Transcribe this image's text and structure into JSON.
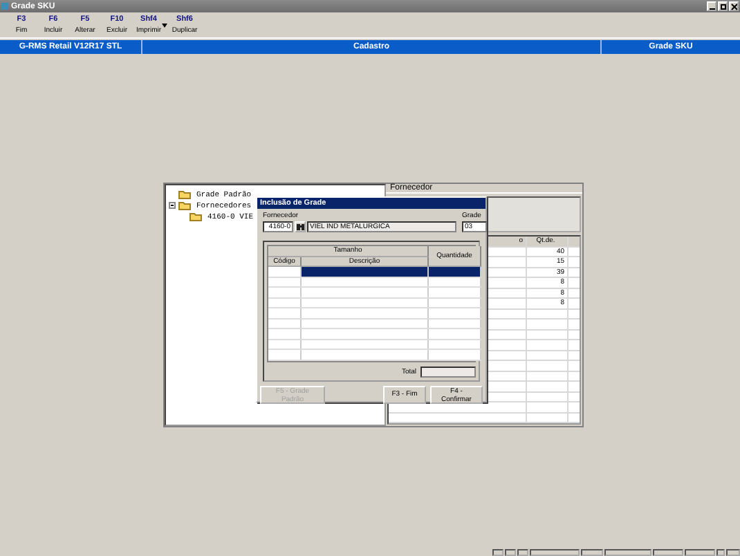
{
  "window": {
    "title": "Grade SKU"
  },
  "toolbar": [
    {
      "key": "F3",
      "label": "Fim",
      "dropdown": false
    },
    {
      "key": "F6",
      "label": "Incluir",
      "dropdown": false
    },
    {
      "key": "F5",
      "label": "Alterar",
      "dropdown": false
    },
    {
      "key": "F10",
      "label": "Excluir",
      "dropdown": false
    },
    {
      "key": "Shf4",
      "label": "Imprimir",
      "dropdown": true
    },
    {
      "key": "Shf6",
      "label": "Duplicar",
      "dropdown": false
    }
  ],
  "header_bar": [
    "G-RMS Retail V12R17 STL",
    "Cadastro",
    "Grade SKU"
  ],
  "tree": [
    {
      "label": "Grade Padrão"
    },
    {
      "label": "Fornecedores",
      "expanded": true,
      "children": [
        {
          "label": "4160-0 VIE"
        }
      ]
    }
  ],
  "right_panel": {
    "title": "Fornecedor",
    "columns": [
      "o",
      "Qt.de."
    ],
    "rows": [
      "40",
      "15",
      "39",
      "8",
      "8",
      "8"
    ]
  },
  "dialog": {
    "title": "Inclusão de Grade",
    "supplier_label": "Fornecedor",
    "supplier_code": "4160-0",
    "supplier_name": "VIEL IND METALURGICA",
    "grade_label": "Grade",
    "grade": "03",
    "group_header": "Tamanho",
    "columns": [
      "Código",
      "Descrição",
      "Quantidade"
    ],
    "rows": [
      {
        "selected": true
      },
      {
        "selected": false
      },
      {
        "selected": false
      },
      {
        "selected": false
      },
      {
        "selected": false
      },
      {
        "selected": false
      },
      {
        "selected": false
      },
      {
        "selected": false
      },
      {
        "selected": false
      }
    ],
    "total_label": "Total",
    "buttons": [
      {
        "label": "F5 - Grade Padrão",
        "disabled": true
      },
      {
        "label": "F3 - Fim",
        "disabled": false
      },
      {
        "label": "F4 - Confirmar",
        "disabled": false
      }
    ]
  }
}
